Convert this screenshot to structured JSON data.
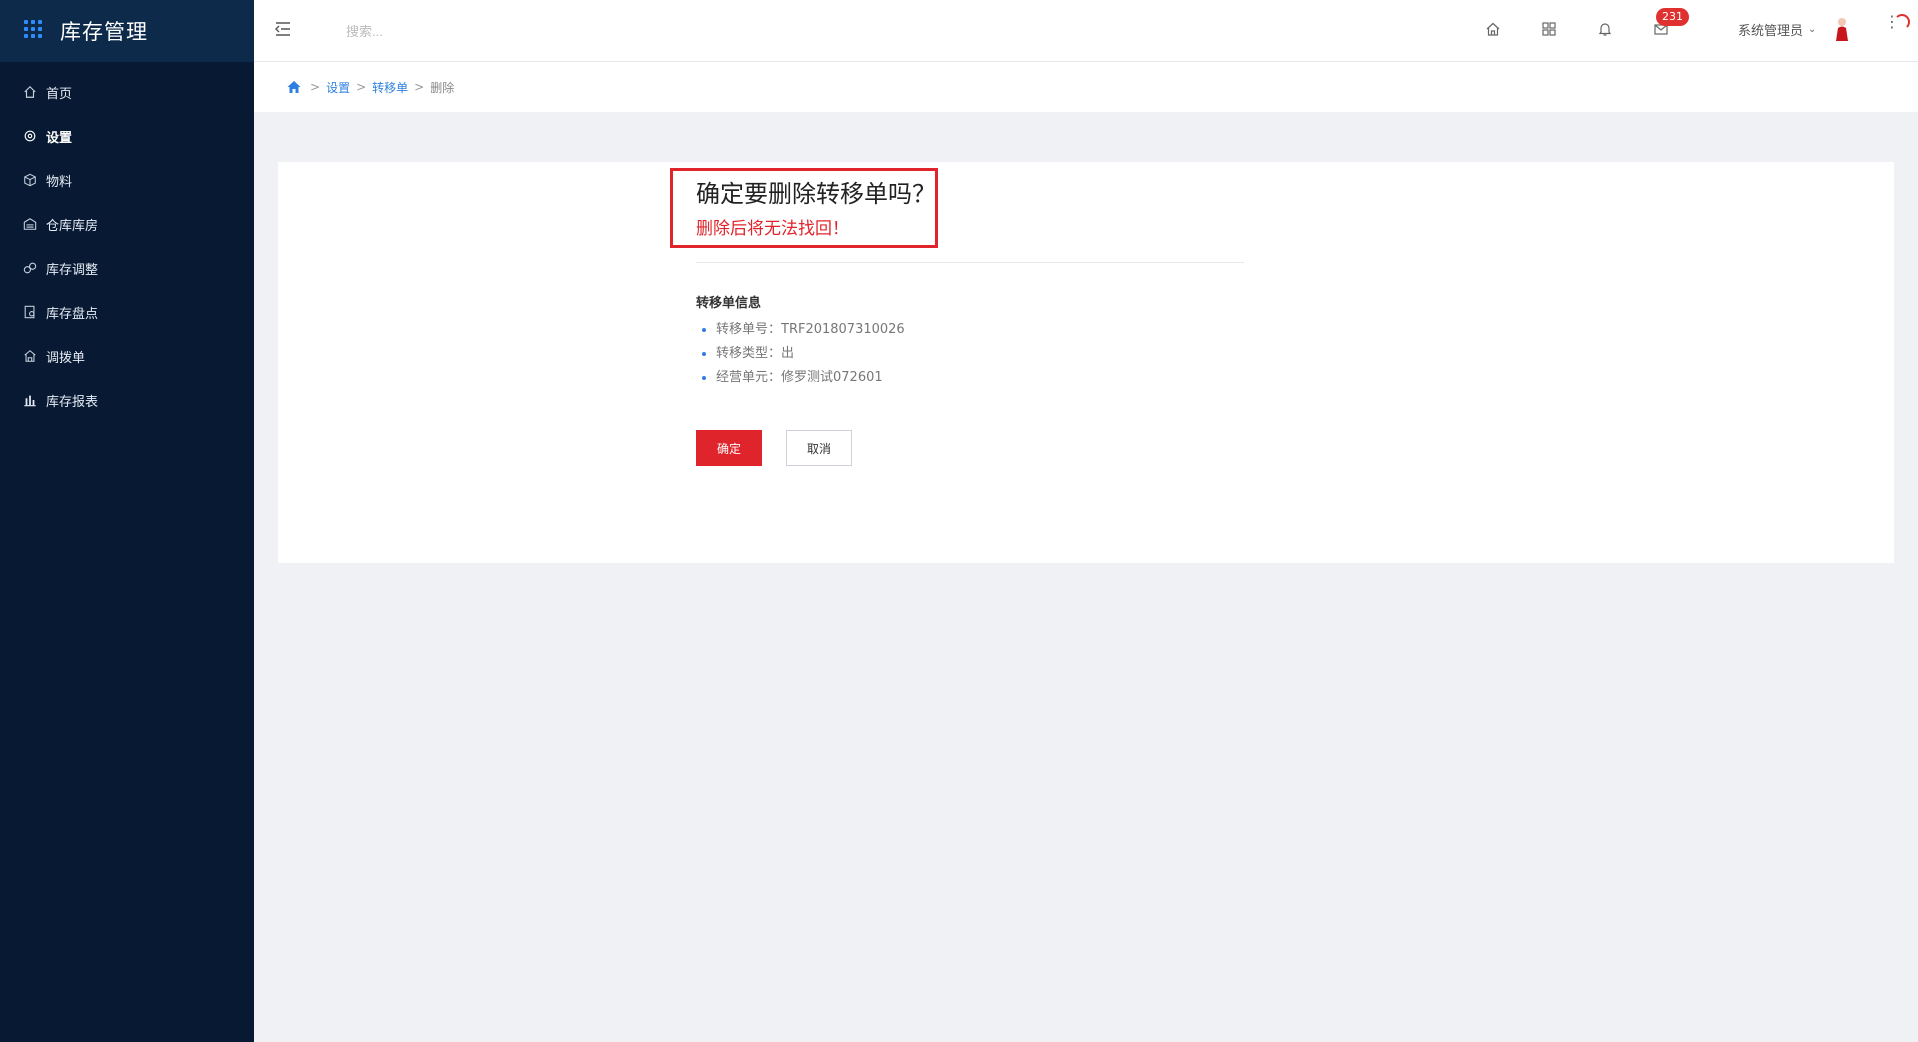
{
  "app": {
    "title": "库存管理"
  },
  "sidebar": {
    "items": [
      {
        "label": "首页",
        "icon": "home-icon",
        "active": false
      },
      {
        "label": "设置",
        "icon": "gear-icon",
        "active": true
      },
      {
        "label": "物料",
        "icon": "cube-icon",
        "active": false
      },
      {
        "label": "仓库库房",
        "icon": "warehouse-icon",
        "active": false
      },
      {
        "label": "库存调整",
        "icon": "adjust-icon",
        "active": false
      },
      {
        "label": "库存盘点",
        "icon": "inventory-check-icon",
        "active": false
      },
      {
        "label": "调拨单",
        "icon": "transfer-icon",
        "active": false
      },
      {
        "label": "库存报表",
        "icon": "bar-chart-icon",
        "active": false
      }
    ]
  },
  "topbar": {
    "search_placeholder": "搜索...",
    "badge_count": "231",
    "user_name": "系统管理员",
    "icons": [
      "home-icon",
      "apps-grid-icon",
      "bell-icon",
      "mail-icon"
    ]
  },
  "breadcrumb": {
    "items": [
      "设置",
      "转移单",
      "删除"
    ]
  },
  "confirm": {
    "title": "确定要删除转移单吗？",
    "warning": "删除后将无法找回！",
    "info_title": "转移单信息",
    "info_items": [
      "转移单号：TRF201807310026",
      "转移类型：出",
      "经营单元：修罗测试072601"
    ],
    "ok_label": "确定",
    "cancel_label": "取消"
  },
  "colors": {
    "sidebar_bg": "#081a33",
    "accent_red": "#e0242b",
    "link_blue": "#2f7fe0"
  }
}
